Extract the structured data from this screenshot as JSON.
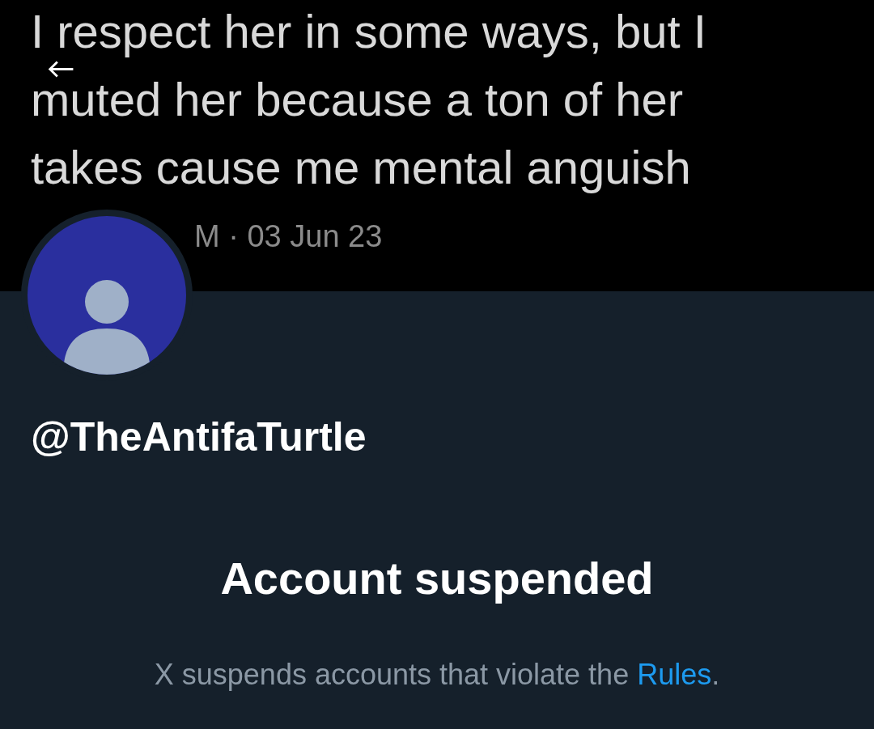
{
  "banner": {
    "kind": "tweet-screenshot",
    "tweet_lines": [
      "I respect her in some ways, but I",
      "muted her because a ton of her",
      "takes cause me mental anguish"
    ],
    "timestamp": "M · 03 Jun 23"
  },
  "profile": {
    "handle": "@TheAntifaTurtle"
  },
  "suspension": {
    "title": "Account suspended",
    "message": "X suspends accounts that violate the ",
    "link": "Rules",
    "message_end": "."
  }
}
